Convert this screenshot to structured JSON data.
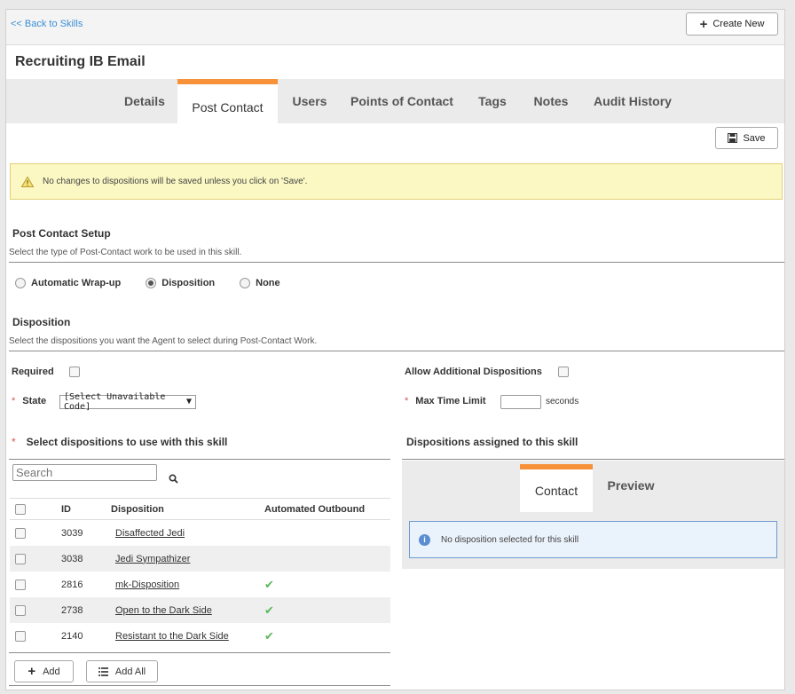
{
  "header": {
    "back_link": "<< Back to Skills",
    "create_new_label": "Create New"
  },
  "page_title": "Recruiting IB Email",
  "tabs": [
    {
      "label": "Details"
    },
    {
      "label": "Post Contact",
      "active": true
    },
    {
      "label": "Users"
    },
    {
      "label": "Points of Contact"
    },
    {
      "label": "Tags"
    },
    {
      "label": "Notes"
    },
    {
      "label": "Audit History"
    }
  ],
  "save_label": "Save",
  "warning_text": "No changes to dispositions will be saved unless you click on 'Save'.",
  "post_contact_setup": {
    "title": "Post Contact Setup",
    "subtitle": "Select the type of Post-Contact work to be used in this skill.",
    "options": [
      "Automatic Wrap-up",
      "Disposition",
      "None"
    ],
    "selected": "Disposition"
  },
  "disposition": {
    "title": "Disposition",
    "subtitle": "Select the dispositions you want the Agent to select during Post-Contact Work.",
    "required_label": "Required",
    "allow_additional_label": "Allow Additional Dispositions",
    "state_label": "State",
    "state_value": "[Select Unavailable Code]",
    "max_time_label": "Max Time Limit",
    "max_time_value": "",
    "seconds_label": "seconds"
  },
  "select_section": {
    "title": "Select dispositions to use with this skill",
    "search_placeholder": "Search",
    "columns": [
      "ID",
      "Disposition",
      "Automated Outbound"
    ],
    "rows": [
      {
        "id": "3039",
        "name": "Disaffected Jedi",
        "automated": false
      },
      {
        "id": "3038",
        "name": "Jedi Sympathizer",
        "automated": false
      },
      {
        "id": "2816",
        "name": "mk-Disposition",
        "automated": true
      },
      {
        "id": "2738",
        "name": "Open to the Dark Side",
        "automated": true
      },
      {
        "id": "2140",
        "name": "Resistant to the Dark Side",
        "automated": true
      }
    ],
    "add_label": "Add",
    "add_all_label": "Add All"
  },
  "assigned_section": {
    "title": "Dispositions assigned to this skill",
    "tabs": [
      "Contact",
      "Preview"
    ],
    "active_tab": "Contact",
    "empty_message": "No disposition selected for this skill"
  },
  "colors": {
    "accent_orange": "#f7913a",
    "link_blue": "#3a8fd6",
    "warning_bg": "#fbf8c3",
    "info_bg": "#eaf2fb",
    "check_green": "#5cb85c",
    "required_red": "#d9534f"
  }
}
